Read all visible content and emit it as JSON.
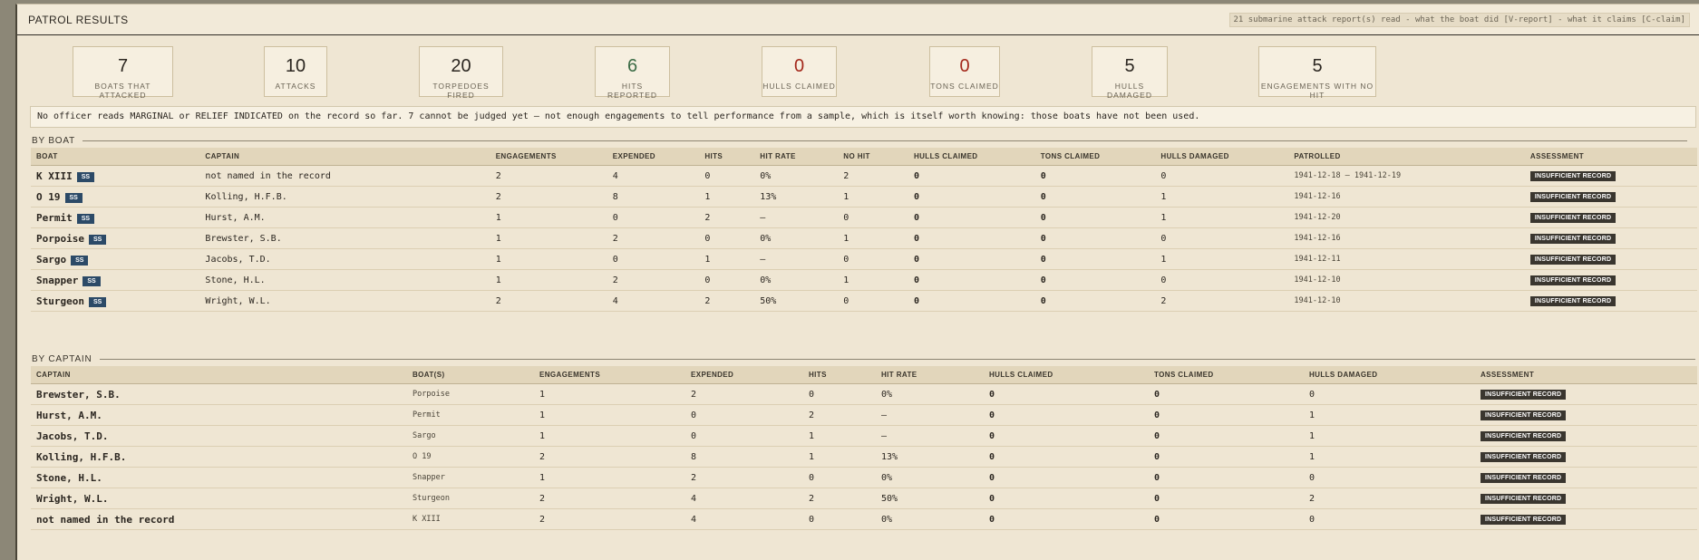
{
  "window": {
    "title": "PATROL RESULTS",
    "subtitle": "21 submarine attack report(s) read - what the boat did [V-report] - what it claims [C-claim]"
  },
  "stats": [
    {
      "value": "7",
      "label": "BOATS THAT ATTACKED",
      "tone": "normal"
    },
    {
      "value": "10",
      "label": "ATTACKS",
      "tone": "normal"
    },
    {
      "value": "20",
      "label": "TORPEDOES FIRED",
      "tone": "normal"
    },
    {
      "value": "6",
      "label": "HITS REPORTED",
      "tone": "green"
    },
    {
      "value": "0",
      "label": "HULLS CLAIMED",
      "tone": "red"
    },
    {
      "value": "0",
      "label": "TONS CLAIMED",
      "tone": "red"
    },
    {
      "value": "5",
      "label": "HULLS DAMAGED",
      "tone": "normal"
    },
    {
      "value": "5",
      "label": "ENGAGEMENTS WITH NO HIT",
      "tone": "normal"
    }
  ],
  "note": "No officer reads MARGINAL or RELIEF INDICATED on the record so far. 7 cannot be judged yet — not enough engagements to tell performance from a sample, which is itself worth knowing: those boats have not been used.",
  "by_boat": {
    "heading": "BY BOAT",
    "columns": [
      "BOAT",
      "CAPTAIN",
      "ENGAGEMENTS",
      "EXPENDED",
      "HITS",
      "HIT RATE",
      "NO HIT",
      "HULLS CLAIMED",
      "TONS CLAIMED",
      "HULLS DAMAGED",
      "PATROLLED",
      "ASSESSMENT"
    ],
    "rows": [
      {
        "boat": "K XIII",
        "type": "SS",
        "captain": "not named in the record",
        "engagements": "2",
        "expended": "4",
        "hits": "0",
        "hit_rate": "0%",
        "no_hit": "2",
        "hulls_claimed": "0",
        "tons_claimed": "0",
        "hulls_damaged": "0",
        "patrolled": "1941-12-18 – 1941-12-19",
        "assessment": "INSUFFICIENT RECORD"
      },
      {
        "boat": "O 19",
        "type": "SS",
        "captain": "Kolling, H.F.B.",
        "engagements": "2",
        "expended": "8",
        "hits": "1",
        "hit_rate": "13%",
        "no_hit": "1",
        "hulls_claimed": "0",
        "tons_claimed": "0",
        "hulls_damaged": "1",
        "patrolled": "1941-12-16",
        "assessment": "INSUFFICIENT RECORD"
      },
      {
        "boat": "Permit",
        "type": "SS",
        "captain": "Hurst, A.M.",
        "engagements": "1",
        "expended": "0",
        "hits": "2",
        "hit_rate": "—",
        "no_hit": "0",
        "hulls_claimed": "0",
        "tons_claimed": "0",
        "hulls_damaged": "1",
        "patrolled": "1941-12-20",
        "assessment": "INSUFFICIENT RECORD"
      },
      {
        "boat": "Porpoise",
        "type": "SS",
        "captain": "Brewster, S.B.",
        "engagements": "1",
        "expended": "2",
        "hits": "0",
        "hit_rate": "0%",
        "no_hit": "1",
        "hulls_claimed": "0",
        "tons_claimed": "0",
        "hulls_damaged": "0",
        "patrolled": "1941-12-16",
        "assessment": "INSUFFICIENT RECORD"
      },
      {
        "boat": "Sargo",
        "type": "SS",
        "captain": "Jacobs, T.D.",
        "engagements": "1",
        "expended": "0",
        "hits": "1",
        "hit_rate": "—",
        "no_hit": "0",
        "hulls_claimed": "0",
        "tons_claimed": "0",
        "hulls_damaged": "1",
        "patrolled": "1941-12-11",
        "assessment": "INSUFFICIENT RECORD"
      },
      {
        "boat": "Snapper",
        "type": "SS",
        "captain": "Stone, H.L.",
        "engagements": "1",
        "expended": "2",
        "hits": "0",
        "hit_rate": "0%",
        "no_hit": "1",
        "hulls_claimed": "0",
        "tons_claimed": "0",
        "hulls_damaged": "0",
        "patrolled": "1941-12-10",
        "assessment": "INSUFFICIENT RECORD"
      },
      {
        "boat": "Sturgeon",
        "type": "SS",
        "captain": "Wright, W.L.",
        "engagements": "2",
        "expended": "4",
        "hits": "2",
        "hit_rate": "50%",
        "no_hit": "0",
        "hulls_claimed": "0",
        "tons_claimed": "0",
        "hulls_damaged": "2",
        "patrolled": "1941-12-10",
        "assessment": "INSUFFICIENT RECORD"
      }
    ]
  },
  "by_captain": {
    "heading": "BY CAPTAIN",
    "columns": [
      "CAPTAIN",
      "BOAT(S)",
      "ENGAGEMENTS",
      "EXPENDED",
      "HITS",
      "HIT RATE",
      "HULLS CLAIMED",
      "TONS CLAIMED",
      "HULLS DAMAGED",
      "ASSESSMENT"
    ],
    "rows": [
      {
        "captain": "Brewster, S.B.",
        "boats": "Porpoise",
        "engagements": "1",
        "expended": "2",
        "hits": "0",
        "hit_rate": "0%",
        "hulls_claimed": "0",
        "tons_claimed": "0",
        "hulls_damaged": "0",
        "assessment": "INSUFFICIENT RECORD"
      },
      {
        "captain": "Hurst, A.M.",
        "boats": "Permit",
        "engagements": "1",
        "expended": "0",
        "hits": "2",
        "hit_rate": "—",
        "hulls_claimed": "0",
        "tons_claimed": "0",
        "hulls_damaged": "1",
        "assessment": "INSUFFICIENT RECORD"
      },
      {
        "captain": "Jacobs, T.D.",
        "boats": "Sargo",
        "engagements": "1",
        "expended": "0",
        "hits": "1",
        "hit_rate": "—",
        "hulls_claimed": "0",
        "tons_claimed": "0",
        "hulls_damaged": "1",
        "assessment": "INSUFFICIENT RECORD"
      },
      {
        "captain": "Kolling, H.F.B.",
        "boats": "O 19",
        "engagements": "2",
        "expended": "8",
        "hits": "1",
        "hit_rate": "13%",
        "hulls_claimed": "0",
        "tons_claimed": "0",
        "hulls_damaged": "1",
        "assessment": "INSUFFICIENT RECORD"
      },
      {
        "captain": "Stone, H.L.",
        "boats": "Snapper",
        "engagements": "1",
        "expended": "2",
        "hits": "0",
        "hit_rate": "0%",
        "hulls_claimed": "0",
        "tons_claimed": "0",
        "hulls_damaged": "0",
        "assessment": "INSUFFICIENT RECORD"
      },
      {
        "captain": "Wright, W.L.",
        "boats": "Sturgeon",
        "engagements": "2",
        "expended": "4",
        "hits": "2",
        "hit_rate": "50%",
        "hulls_claimed": "0",
        "tons_claimed": "0",
        "hulls_damaged": "2",
        "assessment": "INSUFFICIENT RECORD"
      },
      {
        "captain": "not named in the record",
        "boats": "K XIII",
        "engagements": "2",
        "expended": "4",
        "hits": "0",
        "hit_rate": "0%",
        "hulls_claimed": "0",
        "tons_claimed": "0",
        "hulls_damaged": "0",
        "assessment": "INSUFFICIENT RECORD"
      }
    ]
  }
}
